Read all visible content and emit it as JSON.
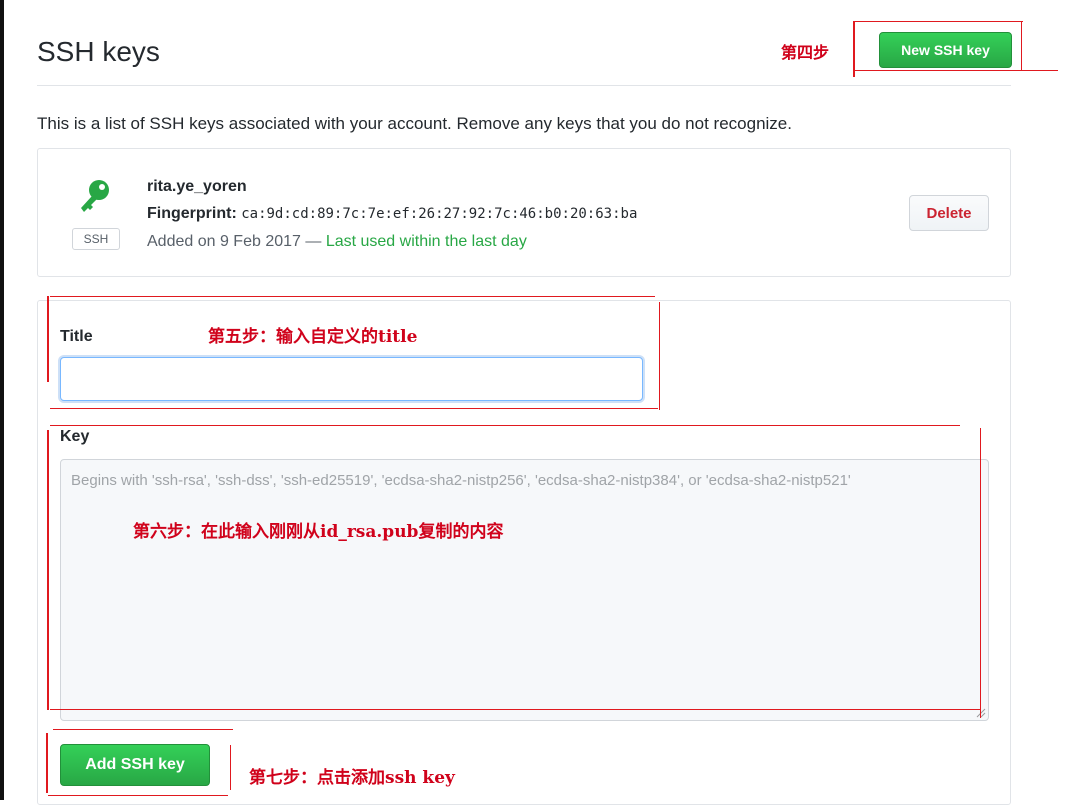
{
  "page": {
    "title": "SSH keys",
    "description": "This is a list of SSH keys associated with your account. Remove any keys that you do not recognize."
  },
  "toolbar": {
    "new_key_label": "New SSH key"
  },
  "key": {
    "badge": "SSH",
    "name": "rita.ye_yoren",
    "fingerprint_label": "Fingerprint:",
    "fingerprint": "ca:9d:cd:89:7c:7e:ef:26:27:92:7c:46:b0:20:63:ba",
    "added": "Added on 9 Feb 2017 —",
    "last_used": "Last used within the last day",
    "delete_label": "Delete"
  },
  "form": {
    "title_label": "Title",
    "title_value": "",
    "key_label": "Key",
    "key_placeholder": "Begins with 'ssh-rsa', 'ssh-dss', 'ssh-ed25519', 'ecdsa-sha2-nistp256', 'ecdsa-sha2-nistp384', or 'ecdsa-sha2-nistp521'",
    "submit_label": "Add SSH key"
  },
  "annotations": {
    "step4": "第四步",
    "step5": "第五步：输入自定义的title",
    "step6": "第六步：在此输入刚刚从id_rsa.pub复制的内容",
    "step7": "第七步：点击添加ssh key"
  },
  "colors": {
    "accent_green": "#28a745",
    "annotation_red": "#d0021b",
    "delete_red": "#cb2431"
  },
  "icons": {
    "key": "key-icon"
  }
}
